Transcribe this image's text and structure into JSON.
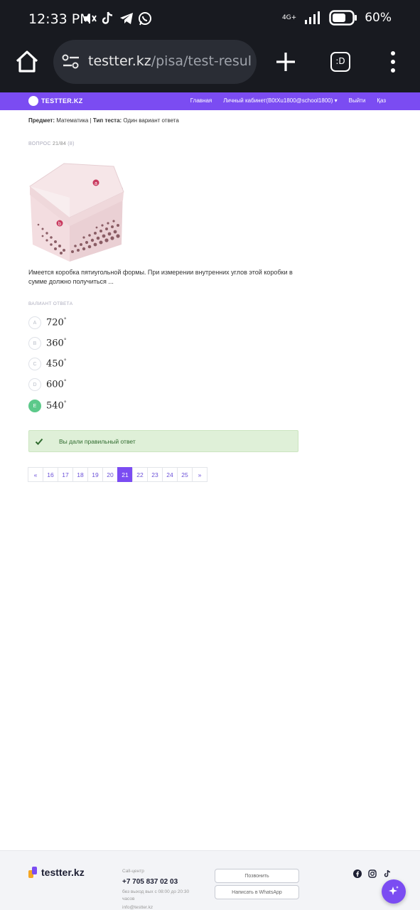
{
  "status_bar": {
    "time": "12:33 PM",
    "network": "4G+",
    "battery": "60%"
  },
  "browser": {
    "url_host": "testter.kz",
    "url_path": "/pisa/test-result/s",
    "tab_count": ":D"
  },
  "site_nav": {
    "brand": "TESTTER.KZ",
    "links": [
      "Главная",
      "Личный кабинет(B0tXu1800@school1800) ▾",
      "Выйти",
      "Қаз"
    ]
  },
  "meta": {
    "subject_label": "Предмет:",
    "subject_value": "Математика",
    "separator": "|",
    "type_label": "Тип теста:",
    "type_value": "Один вариант ответа"
  },
  "question": {
    "label": "ВОПРОС",
    "number": "21/84",
    "count": "(8)",
    "text": "Имеется коробка пятиугольной формы. При измерении внутренних углов этой коробки в сумме должно получиться ...",
    "image_labels": [
      "a",
      "b"
    ]
  },
  "answers": {
    "label": "ВАЛИАНТ ОТВЕТА",
    "options": [
      {
        "letter": "A",
        "value": "720",
        "unit": "°"
      },
      {
        "letter": "B",
        "value": "360",
        "unit": "°"
      },
      {
        "letter": "C",
        "value": "450",
        "unit": "°"
      },
      {
        "letter": "D",
        "value": "600",
        "unit": "°"
      },
      {
        "letter": "E",
        "value": "540",
        "unit": "°"
      }
    ],
    "selected": "E"
  },
  "result": {
    "message": "Вы дали правильный ответ",
    "status_color": "#dff0d8"
  },
  "pagination": {
    "prev": "«",
    "pages": [
      "16",
      "17",
      "18",
      "19",
      "20",
      "21",
      "22",
      "23",
      "24",
      "25"
    ],
    "current": "21",
    "next": "»"
  },
  "footer": {
    "brand": "testter.kz",
    "callcenter_label": "Call-центр",
    "phone": "+7 705 837 02 03",
    "hours": "без выход вых с 08:00 до 20:30 часов",
    "email": "info@testter.kz",
    "call_button": "Позвонить",
    "whatsapp_button": "Написать в WhatsApp"
  },
  "colors": {
    "accent": "#7b4cf2",
    "correct": "#5cc98a"
  }
}
